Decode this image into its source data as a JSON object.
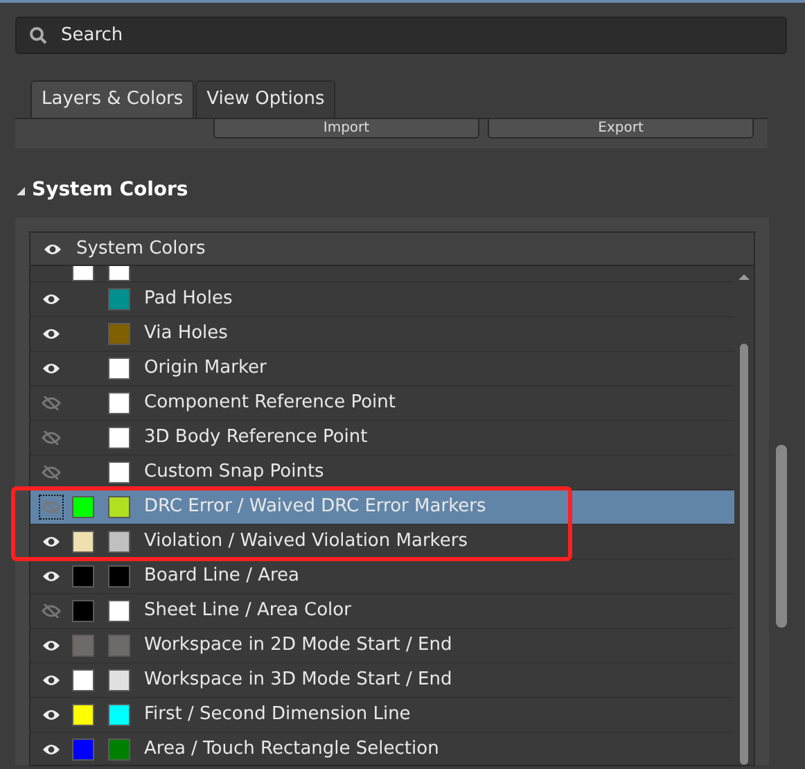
{
  "search": {
    "placeholder": "Search"
  },
  "tabs": [
    {
      "label": "Layers & Colors",
      "selected": true
    },
    {
      "label": "View Options",
      "selected": false
    }
  ],
  "buttons": [
    "Import",
    "Export"
  ],
  "section": {
    "title": "System Colors",
    "expanded": true
  },
  "table": {
    "header": "System Colors",
    "header_visible": true,
    "rows": [
      {
        "kind": "clipped",
        "swatches": [
          {
            "color": "#ffffff"
          },
          {
            "color": "#ffffff"
          }
        ]
      },
      {
        "kind": "single",
        "label": "Pad Holes",
        "visible": true,
        "selected": false,
        "annotated": false,
        "swatches": [
          {
            "color": "#009090"
          }
        ]
      },
      {
        "kind": "single",
        "label": "Via Holes",
        "visible": true,
        "selected": false,
        "annotated": false,
        "swatches": [
          {
            "color": "#806000"
          }
        ]
      },
      {
        "kind": "single",
        "label": "Origin Marker",
        "visible": true,
        "selected": false,
        "annotated": false,
        "swatches": [
          {
            "color": "#ffffff"
          }
        ]
      },
      {
        "kind": "single",
        "label": "Component Reference Point",
        "visible": false,
        "selected": false,
        "annotated": false,
        "swatches": [
          {
            "color": "#ffffff"
          }
        ]
      },
      {
        "kind": "single",
        "label": "3D Body Reference Point",
        "visible": false,
        "selected": false,
        "annotated": false,
        "swatches": [
          {
            "color": "#ffffff"
          }
        ]
      },
      {
        "kind": "single",
        "label": "Custom Snap Points",
        "visible": false,
        "selected": false,
        "annotated": false,
        "swatches": [
          {
            "color": "#ffffff"
          }
        ]
      },
      {
        "kind": "pair",
        "label": "DRC Error / Waived DRC Error Markers",
        "visible": false,
        "selected": true,
        "annotated": true,
        "swatches": [
          {
            "color": "#00ff00"
          },
          {
            "color": "#b0e020"
          }
        ]
      },
      {
        "kind": "pair",
        "label": "Violation / Waived Violation Markers",
        "visible": true,
        "selected": false,
        "annotated": true,
        "swatches": [
          {
            "color": "#f0e0b0"
          },
          {
            "color": "#c0c0c0"
          }
        ]
      },
      {
        "kind": "pair",
        "label": "Board Line / Area",
        "visible": true,
        "selected": false,
        "annotated": false,
        "swatches": [
          {
            "color": "#000000"
          },
          {
            "color": "#000000"
          }
        ]
      },
      {
        "kind": "pair",
        "label": "Sheet Line / Area Color",
        "visible": false,
        "selected": false,
        "annotated": false,
        "swatches": [
          {
            "color": "#000000"
          },
          {
            "color": "#ffffff"
          }
        ]
      },
      {
        "kind": "pair",
        "label": "Workspace in 2D Mode Start / End",
        "visible": true,
        "selected": false,
        "annotated": false,
        "swatches": [
          {
            "color": "#6e6a6a"
          },
          {
            "color": "#6e6a6a"
          }
        ]
      },
      {
        "kind": "pair",
        "label": "Workspace in 3D Mode Start / End",
        "visible": true,
        "selected": false,
        "annotated": false,
        "swatches": [
          {
            "color": "#ffffff"
          },
          {
            "color": "#e0e0e0"
          }
        ]
      },
      {
        "kind": "pair",
        "label": "First / Second Dimension Line",
        "visible": true,
        "selected": false,
        "annotated": false,
        "swatches": [
          {
            "color": "#ffff00"
          },
          {
            "color": "#00ffff"
          }
        ]
      },
      {
        "kind": "pair",
        "label": "Area / Touch Rectangle Selection",
        "visible": true,
        "selected": false,
        "annotated": false,
        "swatches": [
          {
            "color": "#0000ff"
          },
          {
            "color": "#008000"
          }
        ]
      }
    ]
  }
}
